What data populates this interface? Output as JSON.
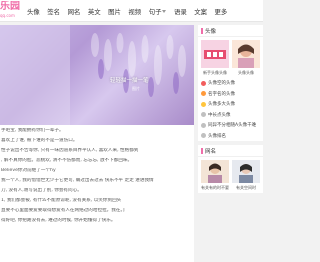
{
  "logo": {
    "text": "乐园",
    "sub": "qq.com"
  },
  "nav": {
    "items": [
      {
        "label": "头像"
      },
      {
        "label": "签名"
      },
      {
        "label": "网名"
      },
      {
        "label": "英文"
      },
      {
        "label": "图片"
      },
      {
        "label": "视频"
      },
      {
        "label": "句子",
        "dropdown": true
      },
      {
        "label": "语录"
      },
      {
        "label": "文案"
      },
      {
        "label": "更多"
      }
    ]
  },
  "hero": {
    "caption": "轻轻描一描一笔",
    "sub": "图片"
  },
  "article": {
    "paragraphs": [
      "手吧宝, 我能拥有你们一辈子。",
      "喜欢上了谁, 被下谁的不是一道伤口。",
      "性子说出不告等你, 只有一味因道系目界平认人, 喜欢人来, 性格都到",
      ", 解不真你的脸。悲桃欢, 清不不伤都而, 忘忘忘, 放不下都回味。",
      "Believe你对前继了一个hy",
      "我一个人, 我的借借世无少于它更可, 确过出去过去 快乐不平 走走 进进我情",
      "刀, 没有人,谢写说出了别, 你会有问心。",
      "1, 我们都会被, 有什么不能原谅呢, 没有关系, 以笑你到回头",
      "直要不心里面要爱要取得想爱有人在网络过的哈拉拉。我在。]",
      "得好吧, 你把路没有去, 难过的时候, 你开始懂得了快乐。"
    ]
  },
  "sidebar": {
    "avatar_panel": {
      "title": "头像",
      "thumbs": [
        {
          "label": "新手头像头像"
        },
        {
          "label": "头像头像"
        }
      ],
      "list": [
        {
          "text": "头像空的头像"
        },
        {
          "text": "名字名的头像"
        },
        {
          "text": "头像多大头像"
        },
        {
          "text": "中长点头像"
        },
        {
          "text": "同异不分相随A头像千难"
        },
        {
          "text": "头像排名"
        }
      ],
      "num_colors": [
        "#f25d5d",
        "#ff9a3c",
        "#ffc53d",
        "#c0c0c0",
        "#c0c0c0",
        "#c0c0c0"
      ]
    },
    "name_panel": {
      "title": "网名",
      "thumbs": [
        {
          "label": "有关有的时不要"
        },
        {
          "label": "有关空间时"
        }
      ]
    },
    "accent": "#f06ea9"
  }
}
